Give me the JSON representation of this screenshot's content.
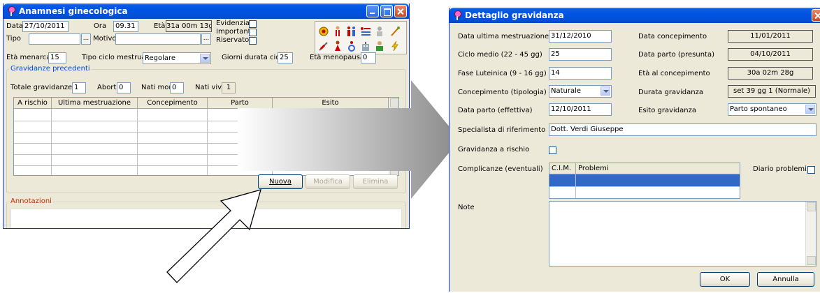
{
  "left": {
    "title": "Anamnesi ginecologica",
    "data_label": "Data",
    "data_value": "27/10/2011",
    "ora_label": "Ora",
    "ora_value": "09.31",
    "eta_label": "Età",
    "eta_value": "31a 00m 13g",
    "evidenzia": "Evidenzia",
    "importante": "Importante",
    "riservato": "Riservato",
    "tipo_label": "Tipo",
    "motivo_label": "Motivo",
    "dots": "...",
    "eta_menarca_label": "Età menarca",
    "eta_menarca_value": "15",
    "tipo_ciclo_label": "Tipo ciclo mestruale",
    "tipo_ciclo_value": "Regolare",
    "giorni_label": "Giorni durata ciclo",
    "giorni_value": "25",
    "eta_menopausa_label": "Età menopausa",
    "eta_menopausa_value": "0",
    "gravidanze_title": "Gravidanze precedenti",
    "totale_label": "Totale gravidanze",
    "totale_value": "1",
    "aborti_label": "Aborti",
    "aborti_value": "0",
    "nati_morti_label": "Nati morti",
    "nati_morti_value": "0",
    "nati_vivi_label": "Nati vivi",
    "nati_vivi_value": "1",
    "columns": [
      "A rischio",
      "Ultima mestruazione",
      "Concepimento",
      "Parto",
      "Esito"
    ],
    "btn_nuova": "Nuova",
    "btn_modifica": "Modifica",
    "btn_elimina": "Elimina",
    "annotazioni": "Annotazioni"
  },
  "right": {
    "title": "Dettaglio gravidanza",
    "ultima_label": "Data ultima mestruazione",
    "ultima_value": "31/12/2010",
    "ciclo_label": "Ciclo medio (22 - 45 gg)",
    "ciclo_value": "25",
    "fase_label": "Fase Luteinica (9 - 16 gg)",
    "fase_value": "14",
    "concepimento_tip_label": "Concepimento (tipologia)",
    "concepimento_tip_value": "Naturale",
    "parto_eff_label": "Data parto (effettiva)",
    "parto_eff_value": "12/10/2011",
    "data_concepimento_label": "Data concepimento",
    "data_concepimento_value": "11/01/2011",
    "data_parto_pres_label": "Data parto (presunta)",
    "data_parto_pres_value": "04/10/2011",
    "eta_conc_label": "Età al concepimento",
    "eta_conc_value": "30a 02m 28g",
    "durata_label": "Durata gravidanza",
    "durata_value": "set 39 gg 1 (Normale)",
    "esito_label": "Esito gravidanza",
    "esito_value": "Parto spontaneo",
    "specialista_label": "Specialista di riferimento",
    "specialista_value": "Dott. Verdi Giuseppe",
    "rischio_label": "Gravidanza a rischio",
    "complicanze_label": "Complicanze (eventuali)",
    "cim_col": "C.I.M.",
    "problemi_col": "Problemi",
    "diario_label": "Diario problemi",
    "note_label": "Note",
    "ok": "OK",
    "annulla": "Annulla"
  },
  "colors": {
    "xp_blue": "#0054e3",
    "dialog_bg": "#ece9d8",
    "selection": "#316ac5",
    "group_title": "#0046d5"
  }
}
